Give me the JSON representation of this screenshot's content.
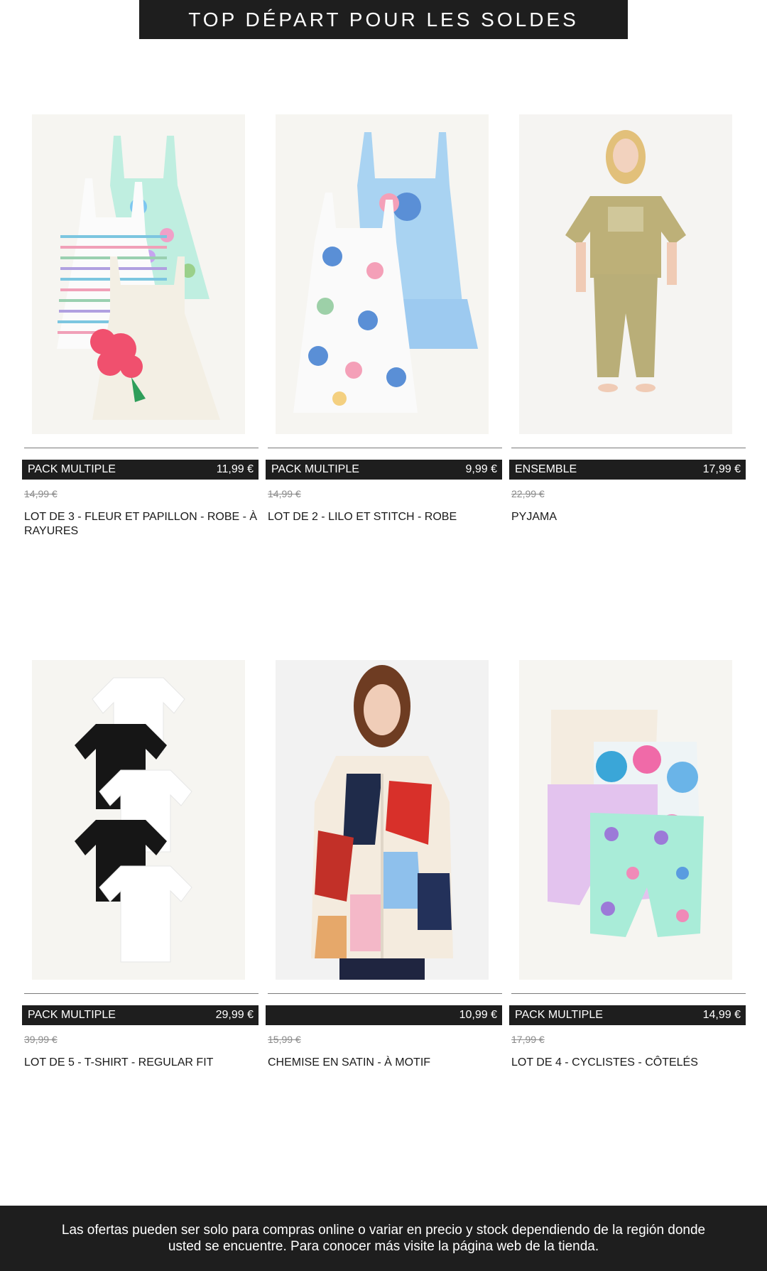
{
  "banner": {
    "title": "TOP DÉPART POUR LES SOLDES"
  },
  "products": [
    {
      "tag": "PACK MULTIPLE",
      "price": "11,99 €",
      "old_price": "14,99 €",
      "title": "LOT DE 3 - FLEUR ET PAPILLON - ROBE - À RAYURES"
    },
    {
      "tag": "PACK MULTIPLE",
      "price": "9,99 €",
      "old_price": "14,99 €",
      "title": "LOT DE 2 - LILO ET STITCH - ROBE"
    },
    {
      "tag": "ENSEMBLE",
      "price": "17,99 €",
      "old_price": "22,99 €",
      "title": "PYJAMA"
    },
    {
      "tag": "PACK MULTIPLE",
      "price": "29,99 €",
      "old_price": "39,99 €",
      "title": "LOT DE 5 - T-SHIRT - REGULAR FIT"
    },
    {
      "tag": "",
      "price": "10,99 €",
      "old_price": "15,99 €",
      "title": "CHEMISE EN SATIN - À MOTIF"
    },
    {
      "tag": "PACK MULTIPLE",
      "price": "14,99 €",
      "old_price": "17,99 €",
      "title": "LOT DE 4 - CYCLISTES - CÔTELÉS"
    }
  ],
  "footer": {
    "text": "Las ofertas pueden ser solo para compras online o variar en precio y stock dependiendo de la región donde usted se encuentre. Para conocer más visite la página web de la tienda."
  },
  "colors": {
    "dark": "#1e1e1e",
    "image_bg": "#f4f3f0",
    "old_price": "#8a8a8a"
  }
}
